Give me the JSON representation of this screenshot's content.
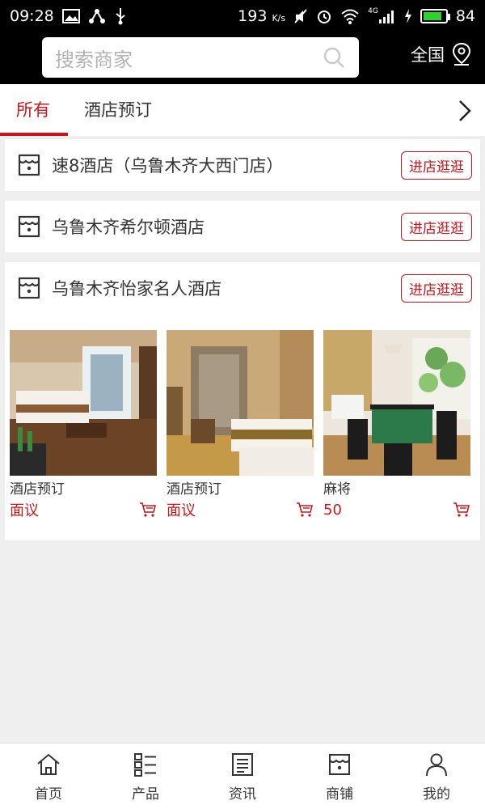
{
  "status_bar": {
    "time": "09:28",
    "network_speed": "193",
    "network_speed_unit": "K/s",
    "signal_label": "4G",
    "battery": "84"
  },
  "header": {
    "search_placeholder": "搜索商家",
    "region_label": "全国"
  },
  "tabs": [
    {
      "label": "所有",
      "active": true
    },
    {
      "label": "酒店预订",
      "active": false
    }
  ],
  "stores": [
    {
      "name": "速8酒店（乌鲁木齐大西门店）",
      "button": "进店逛逛",
      "products": []
    },
    {
      "name": "乌鲁木齐希尔顿酒店",
      "button": "进店逛逛",
      "products": []
    },
    {
      "name": "乌鲁木齐怡家名人酒店",
      "button": "进店逛逛",
      "products": [
        {
          "name": "酒店预订",
          "price": "面议"
        },
        {
          "name": "酒店预订",
          "price": "面议"
        },
        {
          "name": "麻将",
          "price": "50"
        }
      ]
    }
  ],
  "bottom_nav": [
    {
      "label": "首页",
      "icon": "home-icon"
    },
    {
      "label": "产品",
      "icon": "product-list-icon"
    },
    {
      "label": "资讯",
      "icon": "news-icon"
    },
    {
      "label": "商铺",
      "icon": "store-icon"
    },
    {
      "label": "我的",
      "icon": "user-icon"
    }
  ],
  "colors": {
    "accent": "#c8161d",
    "header_bg": "#000000",
    "page_bg": "#efefef"
  }
}
